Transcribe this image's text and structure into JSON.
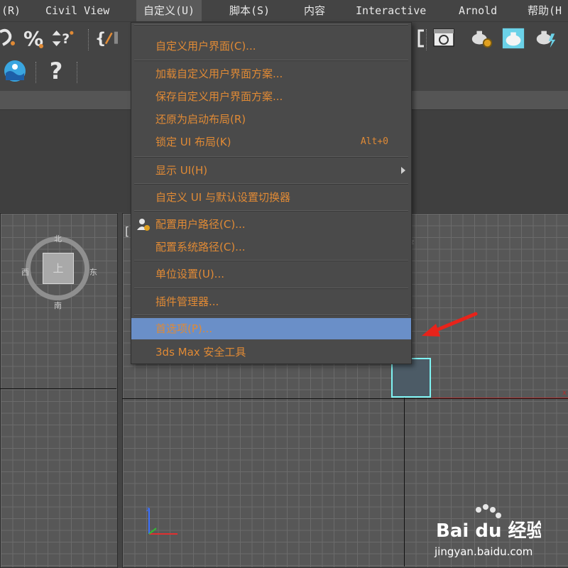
{
  "menubar": {
    "items": [
      {
        "label": "(R)"
      },
      {
        "label": "Civil View"
      },
      {
        "label": "自定义(U)"
      },
      {
        "label": "脚本(S)"
      },
      {
        "label": "内容"
      },
      {
        "label": "Interactive"
      },
      {
        "label": "Arnold"
      },
      {
        "label": "帮助(H"
      }
    ]
  },
  "toolbar": {
    "icons": [
      "snap-icon",
      "percent-snap-icon",
      "spinner-snap-icon",
      "edit-named-selection-icon",
      "render-frame-icon",
      "render-setup-icon",
      "render-icon",
      "render-iterative-icon",
      "water-icon",
      "help-icon"
    ]
  },
  "viewcube": {
    "face": "上",
    "north": "北",
    "south": "南",
    "east": "东",
    "west": "西"
  },
  "main_viewport": {
    "label": "[",
    "axis_z": "z",
    "axis_x": "x"
  },
  "dropdown": {
    "items": [
      {
        "label": "自定义用户界面(C)...",
        "shortcut": ""
      },
      {
        "label": "加载自定义用户界面方案...",
        "shortcut": ""
      },
      {
        "label": "保存自定义用户界面方案...",
        "shortcut": ""
      },
      {
        "label": "还原为启动布局(R)",
        "shortcut": ""
      },
      {
        "label": "锁定 UI 布局(K)",
        "shortcut": "Alt+0"
      },
      {
        "label": "显示 UI(H)",
        "shortcut": ""
      },
      {
        "label": "自定义 UI 与默认设置切换器",
        "shortcut": ""
      },
      {
        "label": "配置用户路径(C)...",
        "shortcut": ""
      },
      {
        "label": "配置系统路径(C)...",
        "shortcut": ""
      },
      {
        "label": "单位设置(U)...",
        "shortcut": ""
      },
      {
        "label": "插件管理器...",
        "shortcut": ""
      },
      {
        "label": "首选项(P)...",
        "shortcut": ""
      },
      {
        "label": "3ds Max 安全工具",
        "shortcut": ""
      }
    ]
  },
  "colors": {
    "menu_text": "#e08a35",
    "highlight": "#6a8fc8",
    "selection": "#7ff3f3",
    "arrow": "#e8231a"
  },
  "watermark": {
    "logo": "Bai du 经验",
    "url": "jingyan.baidu.com"
  }
}
